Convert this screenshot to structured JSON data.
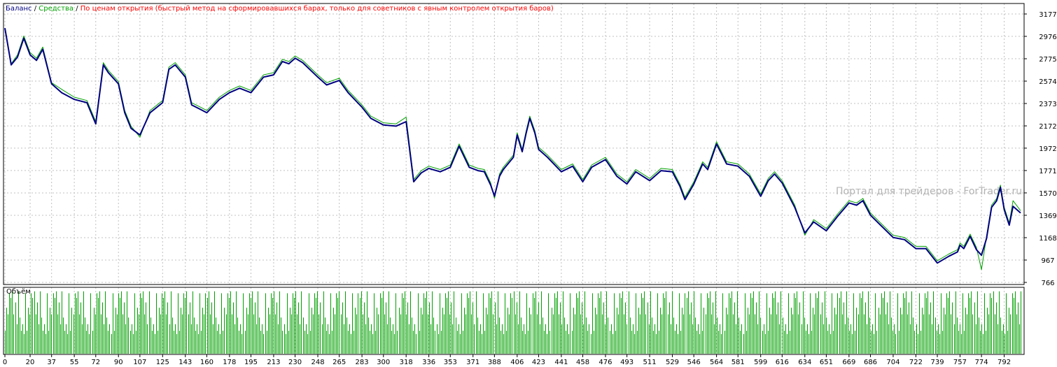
{
  "chart_data": {
    "type": "line",
    "legend": {
      "balance_label": "Баланс",
      "separator": " / ",
      "equity_label": "Средства",
      "method_note": "По ценам открытия (быстрый метод на сформировавшихся барах, только для советников с явным контролем открытия баров)",
      "placement": "top-left"
    },
    "volume_title": "Объём",
    "watermark": "Портал для трейдеров - ForTrader.ru",
    "ylim": [
      766,
      3177
    ],
    "yticks": [
      3177,
      2976,
      2775,
      2574,
      2373,
      2172,
      1972,
      1771,
      1570,
      1369,
      1168,
      967,
      766
    ],
    "xlim": [
      0,
      805
    ],
    "xticks": [
      0,
      20,
      37,
      55,
      72,
      90,
      107,
      125,
      143,
      160,
      178,
      195,
      213,
      230,
      248,
      265,
      283,
      300,
      318,
      336,
      353,
      371,
      388,
      406,
      423,
      441,
      458,
      476,
      493,
      511,
      529,
      546,
      564,
      581,
      599,
      616,
      634,
      651,
      669,
      686,
      704,
      722,
      739,
      757,
      774,
      792
    ],
    "grid": true,
    "colors": {
      "balance": "#000080",
      "equity": "#00a000",
      "method_note": "#ff0000",
      "volume": "#00a000",
      "grid": "#c0c0c0"
    },
    "series": [
      {
        "name": "Баланс",
        "x": [
          0,
          5,
          10,
          15,
          20,
          25,
          30,
          37,
          45,
          55,
          65,
          72,
          78,
          82,
          90,
          95,
          100,
          107,
          115,
          125,
          130,
          135,
          143,
          148,
          155,
          160,
          170,
          178,
          186,
          195,
          205,
          213,
          220,
          225,
          230,
          236,
          248,
          255,
          265,
          272,
          283,
          290,
          300,
          310,
          318,
          324,
          330,
          336,
          345,
          353,
          360,
          368,
          375,
          380,
          385,
          388,
          392,
          395,
          403,
          406,
          410,
          413,
          416,
          420,
          423,
          430,
          441,
          450,
          458,
          465,
          476,
          485,
          493,
          500,
          511,
          520,
          529,
          535,
          539,
          546,
          553,
          557,
          564,
          572,
          581,
          590,
          599,
          605,
          610,
          616,
          626,
          634,
          641,
          651,
          660,
          669,
          675,
          680,
          686,
          694,
          704,
          713,
          722,
          730,
          739,
          748,
          755,
          757,
          760,
          765,
          770,
          774,
          778,
          782,
          786,
          789,
          792,
          796,
          799,
          805
        ],
        "values": [
          3050,
          2720,
          2790,
          2960,
          2810,
          2760,
          2860,
          2550,
          2470,
          2410,
          2380,
          2190,
          2720,
          2650,
          2550,
          2290,
          2150,
          2090,
          2290,
          2380,
          2680,
          2720,
          2610,
          2360,
          2320,
          2290,
          2410,
          2470,
          2510,
          2470,
          2610,
          2630,
          2750,
          2730,
          2780,
          2740,
          2610,
          2540,
          2580,
          2470,
          2340,
          2240,
          2180,
          2170,
          2210,
          1670,
          1750,
          1790,
          1760,
          1800,
          1990,
          1800,
          1770,
          1760,
          1640,
          1540,
          1720,
          1780,
          1890,
          2090,
          1940,
          2100,
          2240,
          2110,
          1960,
          1890,
          1760,
          1810,
          1670,
          1800,
          1870,
          1720,
          1650,
          1760,
          1680,
          1770,
          1760,
          1630,
          1510,
          1650,
          1830,
          1780,
          2010,
          1830,
          1810,
          1720,
          1540,
          1680,
          1740,
          1660,
          1440,
          1210,
          1310,
          1230,
          1360,
          1480,
          1460,
          1500,
          1370,
          1280,
          1170,
          1150,
          1070,
          1070,
          940,
          1000,
          1040,
          1100,
          1070,
          1180,
          1060,
          1010,
          1160,
          1440,
          1500,
          1620,
          1420,
          1280,
          1450,
          1390
        ]
      },
      {
        "name": "Средства",
        "x": [
          0,
          5,
          10,
          15,
          20,
          25,
          30,
          37,
          45,
          55,
          65,
          72,
          78,
          82,
          90,
          95,
          100,
          107,
          115,
          125,
          130,
          135,
          143,
          148,
          155,
          160,
          170,
          178,
          186,
          195,
          205,
          213,
          220,
          225,
          230,
          236,
          248,
          255,
          265,
          272,
          283,
          290,
          300,
          310,
          318,
          324,
          330,
          336,
          345,
          353,
          360,
          368,
          375,
          380,
          385,
          388,
          392,
          395,
          403,
          406,
          410,
          413,
          416,
          420,
          423,
          430,
          441,
          450,
          458,
          465,
          476,
          485,
          493,
          500,
          511,
          520,
          529,
          535,
          539,
          546,
          553,
          557,
          564,
          572,
          581,
          590,
          599,
          605,
          610,
          616,
          626,
          634,
          641,
          651,
          660,
          669,
          675,
          680,
          686,
          694,
          704,
          713,
          722,
          730,
          739,
          748,
          755,
          757,
          760,
          765,
          770,
          774,
          778,
          782,
          786,
          789,
          792,
          796,
          799,
          805
        ],
        "values": [
          3040,
          2730,
          2810,
          2980,
          2830,
          2780,
          2880,
          2560,
          2500,
          2430,
          2400,
          2210,
          2740,
          2670,
          2570,
          2310,
          2170,
          2070,
          2310,
          2400,
          2700,
          2740,
          2630,
          2380,
          2340,
          2310,
          2430,
          2490,
          2530,
          2490,
          2630,
          2650,
          2770,
          2750,
          2800,
          2760,
          2630,
          2560,
          2600,
          2490,
          2360,
          2260,
          2200,
          2190,
          2250,
          1690,
          1770,
          1810,
          1780,
          1820,
          2010,
          1820,
          1790,
          1780,
          1660,
          1520,
          1740,
          1800,
          1910,
          2110,
          1960,
          2120,
          2260,
          2130,
          1980,
          1910,
          1780,
          1830,
          1690,
          1820,
          1890,
          1740,
          1670,
          1780,
          1700,
          1790,
          1780,
          1650,
          1530,
          1670,
          1850,
          1800,
          2030,
          1850,
          1830,
          1740,
          1560,
          1700,
          1760,
          1680,
          1460,
          1190,
          1330,
          1250,
          1380,
          1500,
          1480,
          1520,
          1390,
          1300,
          1190,
          1170,
          1090,
          1090,
          960,
          1020,
          1060,
          1120,
          1090,
          1200,
          1080,
          880,
          1180,
          1460,
          1520,
          1640,
          1440,
          1300,
          1500,
          1410
        ]
      }
    ],
    "volume": {
      "bar_count": 700,
      "x_range": [
        0,
        805
      ],
      "levels": [
        0.35,
        0.78,
        0.92,
        0.55,
        0.6,
        0.3,
        0.95,
        0.7,
        0.45,
        0.85
      ]
    }
  }
}
